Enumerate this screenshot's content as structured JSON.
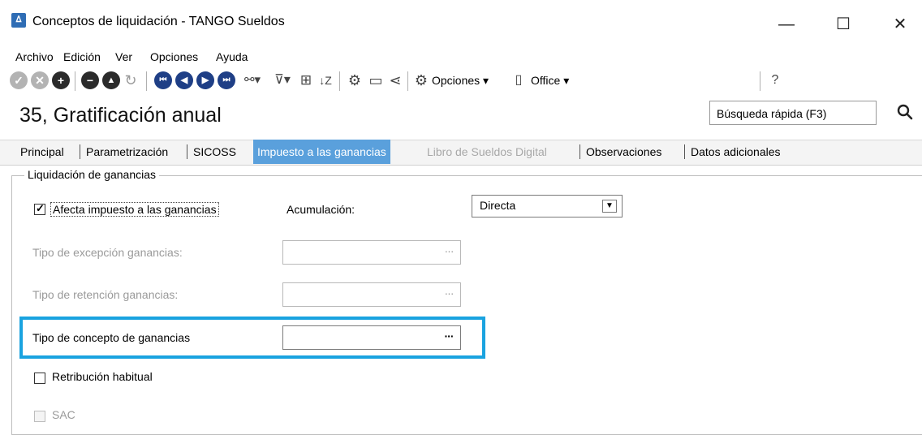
{
  "window": {
    "title": "Conceptos de liquidación - TANGO Sueldos",
    "app_icon": "tango-icon",
    "minimize": "—",
    "maximize": "☐",
    "close": "✕"
  },
  "menu": {
    "items": [
      {
        "label": "Archivo"
      },
      {
        "label": "Edición"
      },
      {
        "label": "Ver"
      },
      {
        "label": "Opciones"
      },
      {
        "label": "Ayuda"
      }
    ]
  },
  "toolbar": {
    "opciones_label": "Opciones",
    "office_label": "Office",
    "colors": {
      "gray": "#9a9a9a",
      "dark": "#2b2b2b",
      "nav": "#1f3f86"
    }
  },
  "header": {
    "record_title": "35, Gratificación anual",
    "search_placeholder": "Búsqueda rápida (F3)"
  },
  "tabs": [
    {
      "label": "Principal",
      "state": "normal"
    },
    {
      "label": "Parametrización",
      "state": "normal"
    },
    {
      "label": "SICOSS",
      "state": "normal"
    },
    {
      "label": "Impuesto a las ganancias",
      "state": "active"
    },
    {
      "label": "Libro de Sueldos Digital",
      "state": "disabled"
    },
    {
      "label": "Observaciones",
      "state": "normal"
    },
    {
      "label": "Datos adicionales",
      "state": "normal"
    }
  ],
  "form": {
    "group_title": "Liquidación de ganancias",
    "afecta_label": "Afecta impuesto a las ganancias",
    "afecta_checked": true,
    "acumulacion_label": "Acumulación:",
    "acumulacion_value": "Directa",
    "tipo_excepcion_label": "Tipo de excepción ganancias:",
    "tipo_retencion_label": "Tipo de retención ganancias:",
    "tipo_concepto_label": "Tipo de concepto de ganancias",
    "lookup_button": "···",
    "retribucion_label": "Retribución habitual",
    "retribucion_checked": false,
    "sac_label": "SAC",
    "sac_checked": false
  },
  "accent": {
    "highlight": "#1aa3e0",
    "active_tab": "#5aa0dc"
  }
}
